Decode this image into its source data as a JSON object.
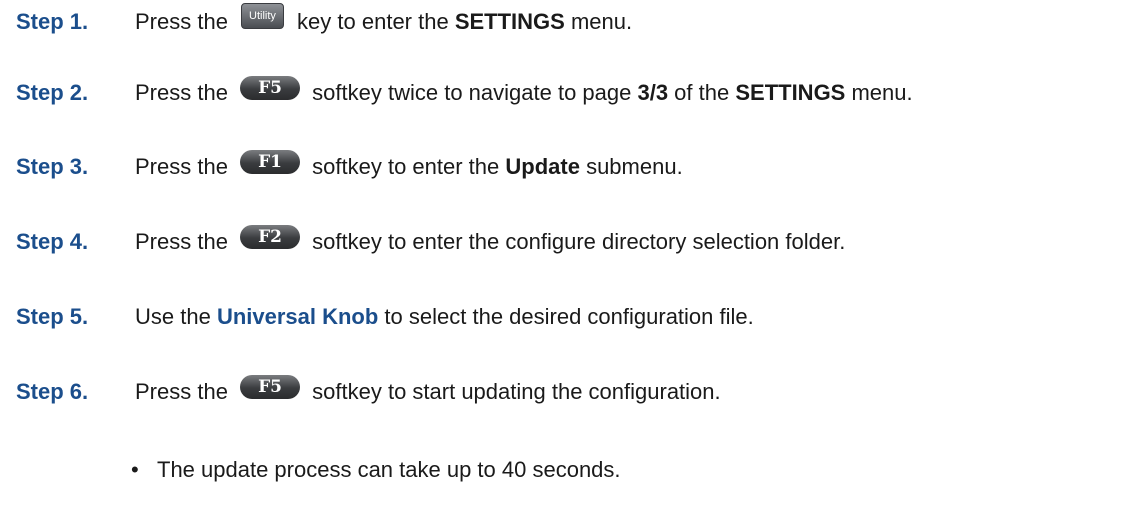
{
  "steps": [
    {
      "label": "Step 1.",
      "pre": "Press the ",
      "key": "Utility",
      "mid": " key to enter the ",
      "bold": "SETTINGS",
      "post": " menu."
    },
    {
      "label": "Step 2.",
      "pre": "Press the ",
      "key": "F5",
      "mid": " softkey twice to navigate to page ",
      "bold": "3/3",
      "mid2": " of the ",
      "bold2": "SETTINGS",
      "post": " menu."
    },
    {
      "label": "Step 3.",
      "pre": "Press the ",
      "key": "F1",
      "mid": " softkey to enter the ",
      "bold": "Update",
      "post": " submenu."
    },
    {
      "label": "Step 4.",
      "pre": "Press the ",
      "key": "F2",
      "mid": " softkey to enter the configure directory selection folder."
    },
    {
      "label": "Step 5.",
      "pre": "Use the ",
      "link": "Universal Knob",
      "post": " to select the desired configuration file."
    },
    {
      "label": "Step 6.",
      "pre": "Press the ",
      "key": "F5",
      "mid": " softkey to start updating the configuration."
    }
  ],
  "bullet": {
    "symbol": "•",
    "text": "The update process can take up to 40 seconds."
  },
  "colors": {
    "step_label": "#1b4e8c",
    "link": "#1b4e8c",
    "text": "#1a1a1a"
  }
}
